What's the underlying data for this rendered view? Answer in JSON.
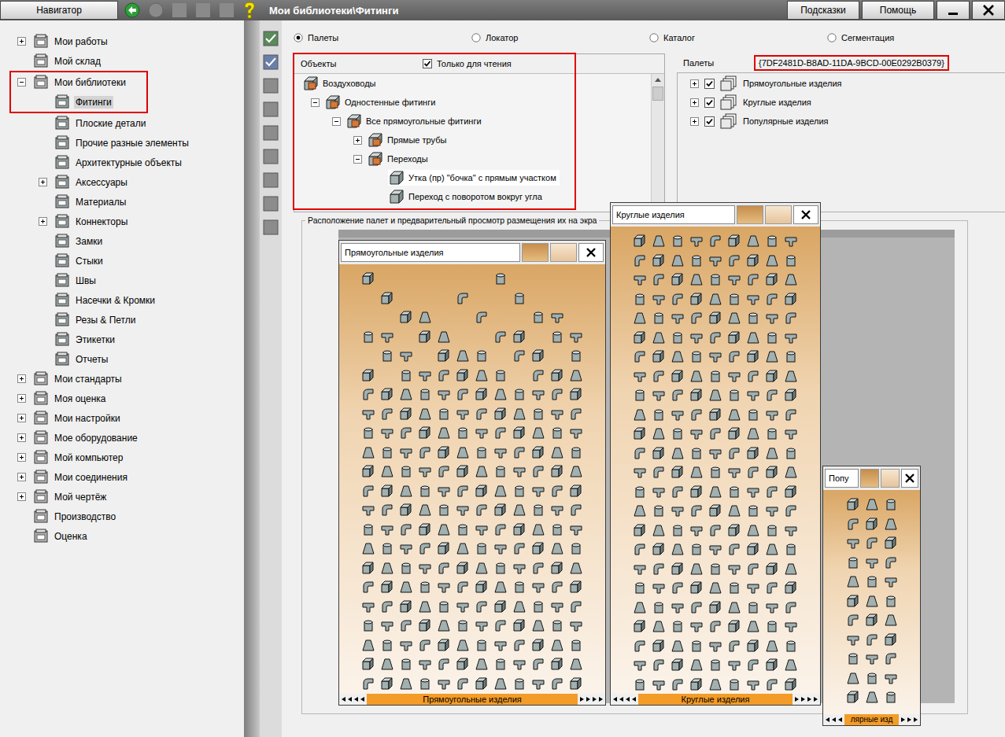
{
  "window": {
    "title": "Мои библиотеки\\Фитинги",
    "nav_button": "Навигатор",
    "buttons": [
      "Подсказки",
      "Помощь"
    ]
  },
  "navigator": {
    "items": [
      {
        "label": "Мои работы",
        "level": 0,
        "has_children": true,
        "expanded": false,
        "selected": false,
        "highlighted": false
      },
      {
        "label": "Мой склад",
        "level": 0,
        "has_children": false,
        "expanded": false,
        "selected": false,
        "highlighted": false
      },
      {
        "label": "Мои библиотеки",
        "level": 0,
        "has_children": true,
        "expanded": true,
        "selected": false,
        "highlighted": true
      },
      {
        "label": "Фитинги",
        "level": 1,
        "has_children": false,
        "expanded": false,
        "selected": true,
        "highlighted": true
      },
      {
        "label": "Плоские детали",
        "level": 1,
        "has_children": false,
        "expanded": false,
        "selected": false,
        "highlighted": false
      },
      {
        "label": "Прочие разные элементы",
        "level": 1,
        "has_children": false,
        "expanded": false,
        "selected": false,
        "highlighted": false
      },
      {
        "label": "Архитектурные объекты",
        "level": 1,
        "has_children": false,
        "expanded": false,
        "selected": false,
        "highlighted": false
      },
      {
        "label": "Аксессуары",
        "level": 1,
        "has_children": true,
        "expanded": false,
        "selected": false,
        "highlighted": false
      },
      {
        "label": "Материалы",
        "level": 1,
        "has_children": false,
        "expanded": false,
        "selected": false,
        "highlighted": false
      },
      {
        "label": "Коннекторы",
        "level": 1,
        "has_children": true,
        "expanded": false,
        "selected": false,
        "highlighted": false
      },
      {
        "label": "Замки",
        "level": 1,
        "has_children": false,
        "expanded": false,
        "selected": false,
        "highlighted": false
      },
      {
        "label": "Стыки",
        "level": 1,
        "has_children": false,
        "expanded": false,
        "selected": false,
        "highlighted": false
      },
      {
        "label": "Швы",
        "level": 1,
        "has_children": false,
        "expanded": false,
        "selected": false,
        "highlighted": false
      },
      {
        "label": "Насечки & Кромки",
        "level": 1,
        "has_children": false,
        "expanded": false,
        "selected": false,
        "highlighted": false
      },
      {
        "label": "Резы & Петли",
        "level": 1,
        "has_children": false,
        "expanded": false,
        "selected": false,
        "highlighted": false
      },
      {
        "label": "Этикетки",
        "level": 1,
        "has_children": false,
        "expanded": false,
        "selected": false,
        "highlighted": false
      },
      {
        "label": "Отчеты",
        "level": 1,
        "has_children": false,
        "expanded": false,
        "selected": false,
        "highlighted": false
      },
      {
        "label": "Мои стандарты",
        "level": 0,
        "has_children": true,
        "expanded": false,
        "selected": false,
        "highlighted": false
      },
      {
        "label": "Моя оценка",
        "level": 0,
        "has_children": true,
        "expanded": false,
        "selected": false,
        "highlighted": false
      },
      {
        "label": "Мои настройки",
        "level": 0,
        "has_children": true,
        "expanded": false,
        "selected": false,
        "highlighted": false
      },
      {
        "label": "Мое оборудование",
        "level": 0,
        "has_children": true,
        "expanded": false,
        "selected": false,
        "highlighted": false
      },
      {
        "label": "Мой компьютер",
        "level": 0,
        "has_children": true,
        "expanded": false,
        "selected": false,
        "highlighted": false
      },
      {
        "label": "Мои соединения",
        "level": 0,
        "has_children": true,
        "expanded": false,
        "selected": false,
        "highlighted": false
      },
      {
        "label": "Мой чертёж",
        "level": 0,
        "has_children": true,
        "expanded": false,
        "selected": false,
        "highlighted": false
      },
      {
        "label": "Производство",
        "level": 0,
        "has_children": false,
        "expanded": false,
        "selected": false,
        "highlighted": false
      },
      {
        "label": "Оценка",
        "level": 0,
        "has_children": false,
        "expanded": false,
        "selected": false,
        "highlighted": false
      }
    ]
  },
  "view_modes": [
    {
      "label": "Палеты",
      "selected": true
    },
    {
      "label": "Локатор",
      "selected": false
    },
    {
      "label": "Каталог",
      "selected": false
    },
    {
      "label": "Сегментация",
      "selected": false
    }
  ],
  "objects": {
    "title": "Объекты",
    "highlighted": true,
    "read_only": {
      "label": "Только для чтения",
      "checked": true
    },
    "items": [
      {
        "label": "Воздуховоды",
        "level": 0,
        "has_children": false,
        "expanded": false,
        "selected": false
      },
      {
        "label": "Одностенные фитинги",
        "level": 1,
        "has_children": true,
        "expanded": true,
        "selected": false
      },
      {
        "label": "Все прямоугольные фитинги",
        "level": 2,
        "has_children": true,
        "expanded": true,
        "selected": false
      },
      {
        "label": "Прямые трубы",
        "level": 3,
        "has_children": true,
        "expanded": false,
        "selected": false
      },
      {
        "label": "Переходы",
        "level": 3,
        "has_children": true,
        "expanded": true,
        "selected": false
      },
      {
        "label": "Утка (пр) \"бочка\" с прямым участком",
        "level": 4,
        "has_children": false,
        "expanded": false,
        "selected": true
      },
      {
        "label": "Переход с поворотом вокруг угла",
        "level": 4,
        "has_children": false,
        "expanded": false,
        "selected": false
      }
    ]
  },
  "palettes_pane": {
    "title": "Палеты",
    "guid": "{7DF2481D-B8AD-11DA-9BCD-00E0292B0379}",
    "guid_highlighted": true,
    "items": [
      {
        "label": "Прямоугольные изделия",
        "expanded": false,
        "checked": true
      },
      {
        "label": "Круглые изделия",
        "expanded": false,
        "checked": true
      },
      {
        "label": "Популярные изделия",
        "expanded": false,
        "checked": true
      }
    ]
  },
  "preview": {
    "legend": "Расположение палет и предварительный просмотр размещения их на экра",
    "windows": [
      {
        "title": "Прямоугольные изделия",
        "footer": "Прямоугольные изделия"
      },
      {
        "title": "Круглые изделия",
        "footer": "Круглые изделия"
      },
      {
        "title": "Попу",
        "footer": "лярные изд"
      }
    ]
  }
}
